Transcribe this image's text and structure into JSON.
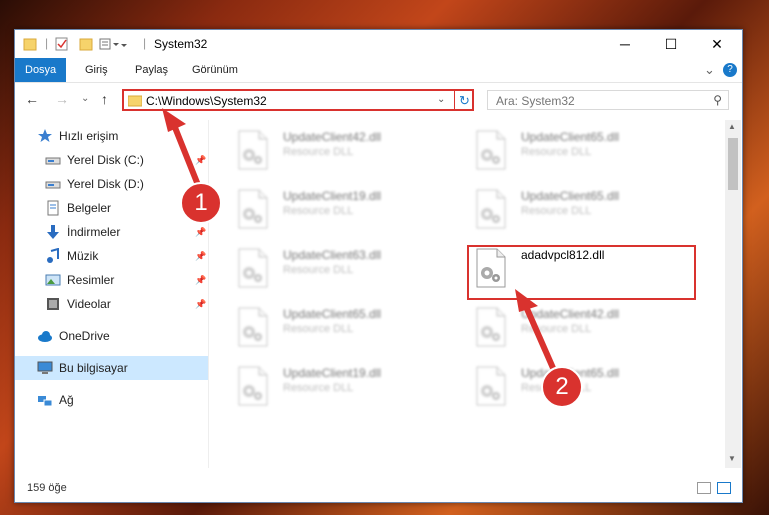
{
  "window": {
    "title": "System32",
    "controls": {
      "minimize": "─",
      "maximize": "☐",
      "close": "✕"
    }
  },
  "ribbon": {
    "tabs": [
      "Dosya",
      "Giriş",
      "Paylaş",
      "Görünüm"
    ],
    "expand": "⌄",
    "help": "?"
  },
  "nav": {
    "back": "←",
    "forward": "→",
    "recent": "⌄",
    "up": "↑",
    "address": "C:\\Windows\\System32",
    "dropdown": "⌄",
    "refresh": "↻",
    "search_placeholder": "Ara: System32",
    "search_icon": "⚲"
  },
  "sidebar": {
    "items": [
      {
        "label": "Hızlı erişim",
        "icon": "star-icon",
        "pinned": false
      },
      {
        "label": "Yerel Disk (C:)",
        "icon": "drive-icon",
        "pinned": true
      },
      {
        "label": "Yerel Disk (D:)",
        "icon": "drive-icon",
        "pinned": false
      },
      {
        "label": "Belgeler",
        "icon": "documents-icon",
        "pinned": true
      },
      {
        "label": "İndirmeler",
        "icon": "download-icon",
        "pinned": true
      },
      {
        "label": "Müzik",
        "icon": "music-icon",
        "pinned": true
      },
      {
        "label": "Resimler",
        "icon": "pictures-icon",
        "pinned": true
      },
      {
        "label": "Videolar",
        "icon": "videos-icon",
        "pinned": true
      },
      {
        "label": "OneDrive",
        "icon": "cloud-icon",
        "pinned": false
      },
      {
        "label": "Bu bilgisayar",
        "icon": "computer-icon",
        "pinned": false,
        "selected": true
      },
      {
        "label": "Ağ",
        "icon": "network-icon",
        "pinned": false
      }
    ]
  },
  "files": [
    {
      "name": "UpdateClient42.dll",
      "type": "Resource DLL"
    },
    {
      "name": "UpdateClient65.dll",
      "type": "Resource DLL"
    },
    {
      "name": "UpdateClient19.dll",
      "type": "Resource DLL"
    },
    {
      "name": "UpdateClient65.dll",
      "type": "Resource DLL"
    },
    {
      "name": "UpdateClient63.dll",
      "type": "Resource DLL"
    },
    {
      "name": "adadvpcl812.dll",
      "type": ""
    },
    {
      "name": "UpdateClient65.dll",
      "type": "Resource DLL"
    },
    {
      "name": "UpdateClient42.dll",
      "type": "Resource DLL"
    },
    {
      "name": "UpdateClient19.dll",
      "type": "Resource DLL"
    },
    {
      "name": "UpdateClient65.dll",
      "type": "Resource DLL"
    }
  ],
  "status": {
    "count": "159 öğe"
  },
  "annotations": {
    "step1": "1",
    "step2": "2",
    "color": "#d9322e"
  }
}
